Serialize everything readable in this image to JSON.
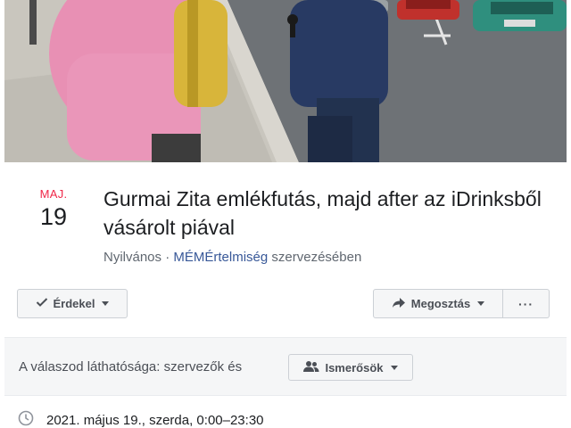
{
  "event": {
    "date_month": "MAJ.",
    "date_day": "19",
    "title": "Gurmai Zita emlékfutás, majd after az iDrinksből vásárolt piával",
    "privacy": "Nyilvános",
    "separator": " · ",
    "organizer": "MÉMÉrtelmiség",
    "organizer_suffix": " szervezésében"
  },
  "actions": {
    "interested_label": "Érdekel",
    "share_label": "Megosztás",
    "more_label": "···"
  },
  "visibility": {
    "text": "A válaszod láthatósága: szervezők és",
    "audience_label": "Ismerősök"
  },
  "details": {
    "datetime": "2021. május 19., szerda, 0:00–23:30"
  },
  "icons": {
    "interested": "check-icon",
    "share": "share-arrow-icon",
    "audience": "friends-icon",
    "datetime": "clock-icon"
  }
}
